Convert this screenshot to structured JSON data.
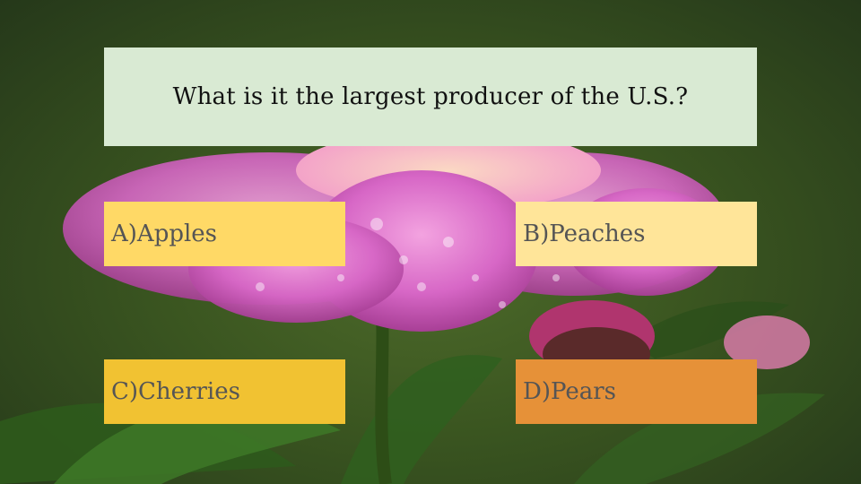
{
  "question": {
    "text": "What is it the largest producer of the U.S.?"
  },
  "answers": [
    {
      "label": "A)Apples",
      "color": "#ffd966"
    },
    {
      "label": "B)Peaches",
      "color": "#ffe599"
    },
    {
      "label": "C)Cherries",
      "color": "#f1c232"
    },
    {
      "label": "D)Pears",
      "color": "#e69138"
    }
  ],
  "theme": {
    "question_box_color": "#d9ead3",
    "background_image": "pink-peony-flower-with-water-drops-icon"
  }
}
